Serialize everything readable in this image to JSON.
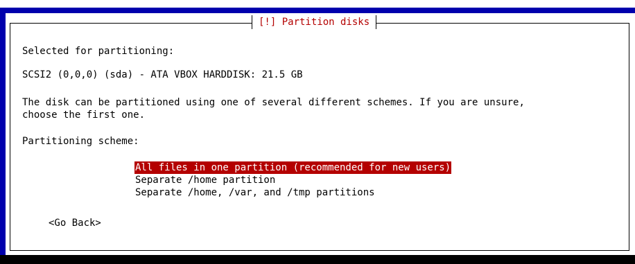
{
  "dialog": {
    "title": "[!] Partition disks",
    "selected_label": "Selected for partitioning:",
    "disk": "SCSI2 (0,0,0) (sda) - ATA VBOX HARDDISK: 21.5 GB",
    "description_line1": "The disk can be partitioned using one of several different schemes. If you are unsure,",
    "description_line2": "choose the first one.",
    "scheme_label": "Partitioning scheme:",
    "options": [
      {
        "label": "All files in one partition (recommended for new users)",
        "selected": true
      },
      {
        "label": "Separate /home partition",
        "selected": false
      },
      {
        "label": "Separate /home, /var, and /tmp partitions",
        "selected": false
      }
    ],
    "go_back": "<Go Back>"
  },
  "colors": {
    "background_blue": "#0000ad",
    "title_red": "#b40000",
    "highlight_red": "#b40000",
    "dialog_white": "#ffffff"
  }
}
